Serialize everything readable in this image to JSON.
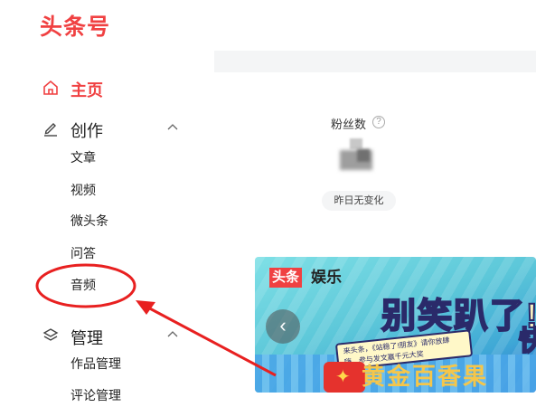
{
  "header": {
    "logo_text": "头条号"
  },
  "sidebar": {
    "home": {
      "label": "主页",
      "icon": "home-icon"
    },
    "create": {
      "label": "创作",
      "icon": "edit-icon",
      "items": [
        "文章",
        "视频",
        "微头条",
        "问答",
        "音频"
      ]
    },
    "manage": {
      "label": "管理",
      "icon": "layers-icon",
      "items": [
        "作品管理",
        "评论管理"
      ]
    }
  },
  "stats": {
    "fans_label": "粉丝数",
    "help_icon_glyph": "?",
    "change_text": "昨日无变化"
  },
  "banner": {
    "brand_box": "头条",
    "brand_text": "娱乐",
    "slogan": "别笑趴了!",
    "sub_text": "来头条，《站稳了!朋友》请你放肆嗨，参与发文赢千元大奖",
    "big_glyph": "快",
    "golden_text": "黄金百香果",
    "prev_glyph": "‹"
  },
  "colors": {
    "brand_red": "#f04142",
    "annotation_red": "#e82020",
    "panel_bg": "#f4f5f6"
  }
}
